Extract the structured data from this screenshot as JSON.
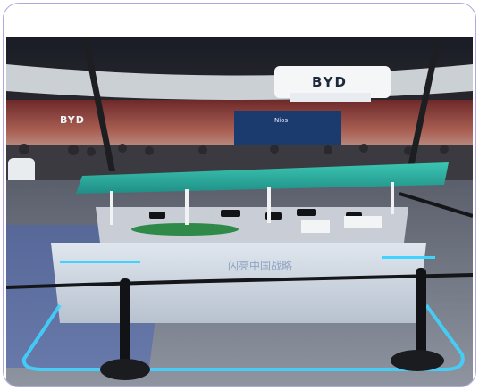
{
  "photo": {
    "brand_signs": [
      "BYD",
      "BYD"
    ],
    "screen_text": "Nios",
    "exhibit_sign": "闪亮中国战略"
  },
  "colors": {
    "frame": "#b3a6dc",
    "table_top": "#2fb0a0",
    "glow": "#3fd3ff"
  }
}
